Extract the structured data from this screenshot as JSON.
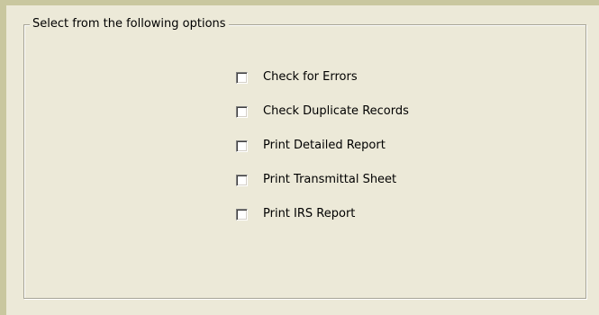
{
  "group": {
    "caption": "Select from the following options"
  },
  "options": [
    {
      "label": "Check for Errors",
      "checked": false
    },
    {
      "label": "Check Duplicate Records",
      "checked": false
    },
    {
      "label": "Print Detailed Report",
      "checked": false
    },
    {
      "label": "Print Transmittal Sheet",
      "checked": false
    },
    {
      "label": "Print IRS Report",
      "checked": false
    }
  ]
}
